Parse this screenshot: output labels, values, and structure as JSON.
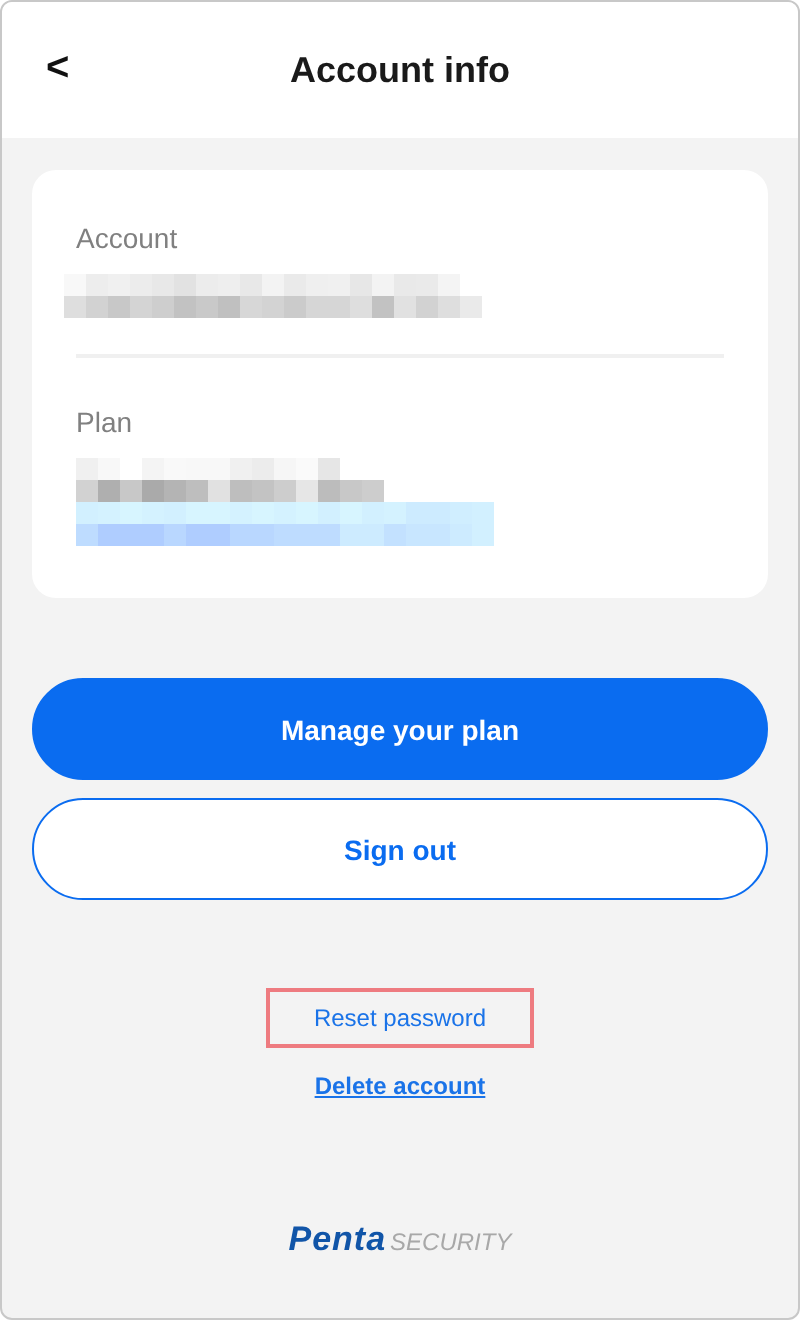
{
  "header": {
    "back": "<",
    "title": "Account info"
  },
  "card": {
    "fields": [
      {
        "label": "Account",
        "kind": "masked"
      },
      {
        "label": "Plan",
        "kind": "masked-link"
      }
    ]
  },
  "buttons": [
    {
      "label": "Manage your plan",
      "kind": "primary"
    },
    {
      "label": "Sign out",
      "kind": "outline"
    }
  ],
  "links": [
    {
      "label": "Reset password",
      "underline": false,
      "highlighted": true
    },
    {
      "label": "Delete account",
      "underline": true,
      "highlighted": false
    }
  ],
  "logo": {
    "brand": "Penta",
    "suffix": "SECURITY"
  }
}
